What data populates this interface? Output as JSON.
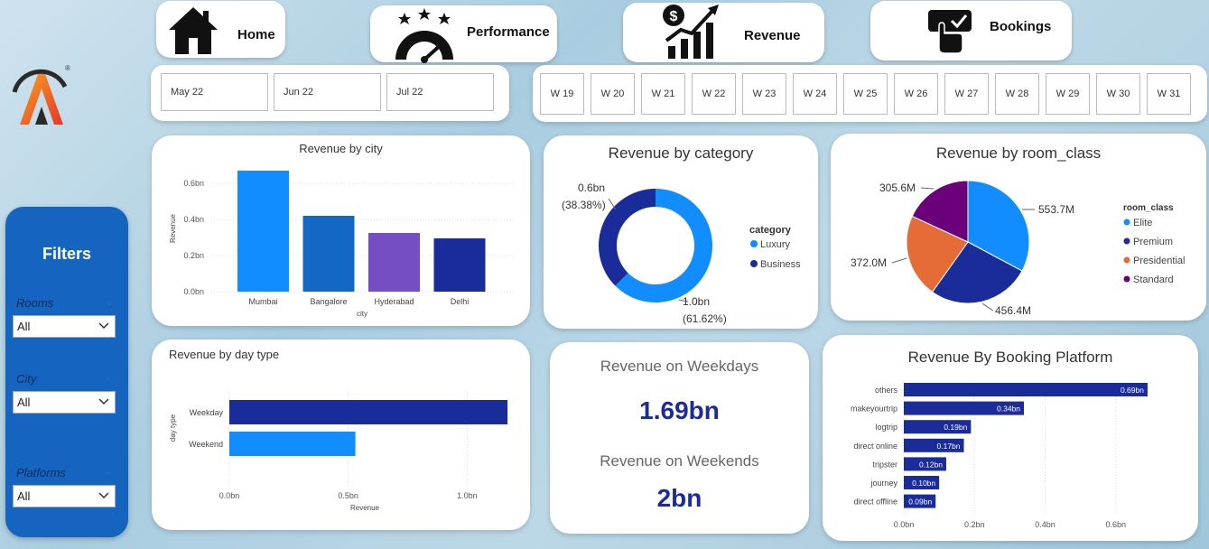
{
  "nav": {
    "home": "Home",
    "performance": "Performance",
    "revenue": "Revenue",
    "bookings": "Bookings"
  },
  "months": [
    "May 22",
    "Jun 22",
    "Jul 22"
  ],
  "weeks": [
    "W 19",
    "W 20",
    "W 21",
    "W 22",
    "W 23",
    "W 24",
    "W 25",
    "W 26",
    "W 27",
    "W 28",
    "W 29",
    "W 30",
    "W 31"
  ],
  "filters": {
    "title": "Filters",
    "rooms_label": "Rooms",
    "rooms_value": "All",
    "city_label": "City",
    "city_value": "All",
    "platforms_label": "Platforms",
    "platforms_value": "All"
  },
  "kpi": {
    "weekdays_label": "Revenue on Weekdays",
    "weekdays_value": "1.69bn",
    "weekends_label": "Revenue on Weekends",
    "weekends_value": "2bn"
  },
  "colors": {
    "accent": "#1565c0",
    "navy": "#1a2b9a",
    "blue": "#118dff"
  },
  "chart_data": [
    {
      "id": "city",
      "type": "bar",
      "title": "Revenue by city",
      "xlabel": "city",
      "ylabel": "Revenue",
      "categories": [
        "Mumbai",
        "Bangalore",
        "Hyderabad",
        "Delhi"
      ],
      "values": [
        0.67,
        0.42,
        0.325,
        0.295
      ],
      "colors": [
        "#118dff",
        "#1268c3",
        "#744ec2",
        "#1a2b9a"
      ],
      "yticks": [
        "0.0bn",
        "0.2bn",
        "0.4bn",
        "0.6bn"
      ],
      "ylim": [
        0,
        0.7
      ],
      "grid": true
    },
    {
      "id": "category",
      "type": "pie",
      "title": "Revenue by category",
      "legend_title": "category",
      "legend": "right",
      "slices": [
        {
          "name": "Luxury",
          "value": 1.0,
          "label": "1.0bn",
          "pct": "(61.62%)",
          "color": "#118dff"
        },
        {
          "name": "Business",
          "value": 0.6,
          "label": "0.6bn",
          "pct": "(38.38%)",
          "color": "#1a2b9a"
        }
      ]
    },
    {
      "id": "room",
      "type": "pie",
      "title": "Revenue by room_class",
      "legend_title": "room_class",
      "legend": "right",
      "slices": [
        {
          "name": "Elite",
          "value": 553.7,
          "label": "553.7M",
          "color": "#118dff"
        },
        {
          "name": "Premium",
          "value": 456.4,
          "label": "456.4M",
          "color": "#1a2b9a"
        },
        {
          "name": "Presidential",
          "value": 372.0,
          "label": "372.0M",
          "color": "#e66c37"
        },
        {
          "name": "Standard",
          "value": 305.6,
          "label": "305.6M",
          "color": "#6b007b"
        }
      ]
    },
    {
      "id": "daytype",
      "type": "bar",
      "orientation": "horizontal",
      "title": "Revenue by day type",
      "xlabel": "Revenue",
      "ylabel": "day type",
      "categories": [
        "Weekday",
        "Weekend"
      ],
      "values": [
        1.17,
        0.53
      ],
      "colors": [
        "#1a2b9a",
        "#118dff"
      ],
      "xticks": [
        "0.0bn",
        "0.5bn",
        "1.0bn"
      ],
      "xlim": [
        0,
        1.2
      ],
      "grid": true
    },
    {
      "id": "platform",
      "type": "bar",
      "orientation": "horizontal",
      "title": "Revenue By Booking Platform",
      "categories": [
        "others",
        "makeyourtrip",
        "logtrip",
        "direct online",
        "tripster",
        "journey",
        "direct offline"
      ],
      "values": [
        0.69,
        0.34,
        0.19,
        0.17,
        0.12,
        0.1,
        0.09
      ],
      "labels": [
        "0.69bn",
        "0.34bn",
        "0.19bn",
        "0.17bn",
        "0.12bn",
        "0.10bn",
        "0.09bn"
      ],
      "color": "#1a2b9a",
      "xticks": [
        "0.0bn",
        "0.2bn",
        "0.4bn",
        "0.6bn"
      ],
      "xlim": [
        0,
        0.8
      ],
      "grid": true
    }
  ]
}
